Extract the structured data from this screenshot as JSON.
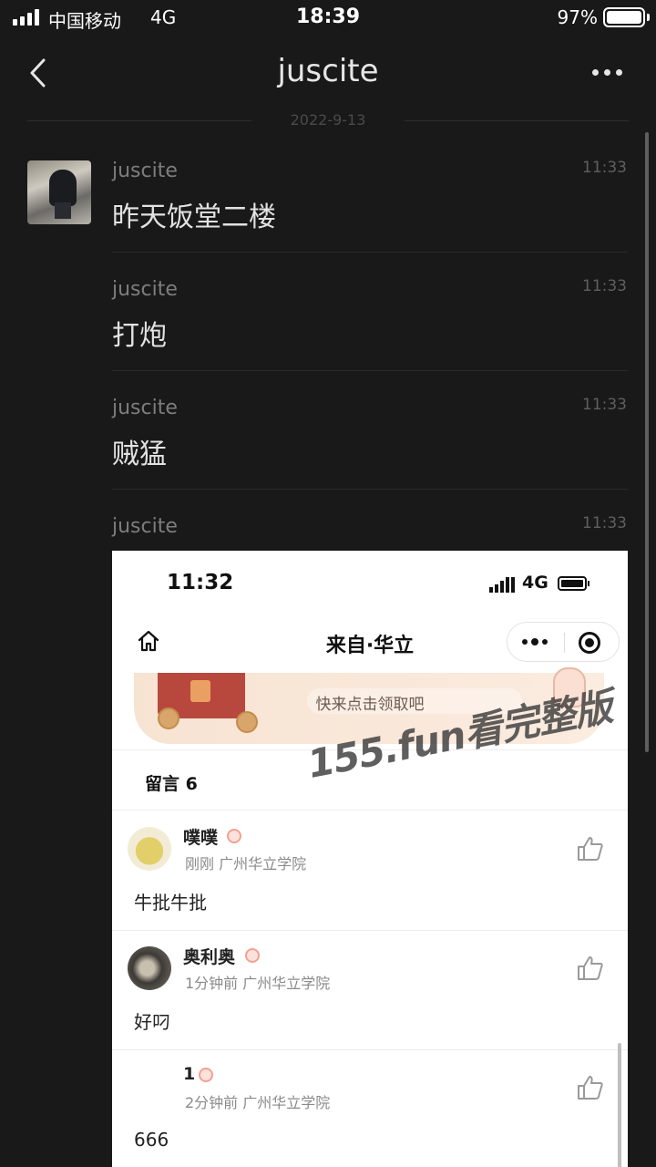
{
  "status_bar": {
    "carrier": "中国移动",
    "network": "4G",
    "time": "18:39",
    "battery": "97%",
    "battery_level": 0.97
  },
  "nav": {
    "title": "juscite",
    "back_icon": "chevron-left-icon",
    "more_icon": "more-dots-icon"
  },
  "date_divider": "2022-9-13",
  "messages": [
    {
      "sender": "juscite",
      "time": "11:33",
      "text": "昨天饭堂二楼"
    },
    {
      "sender": "juscite",
      "time": "11:33",
      "text": "打炮"
    },
    {
      "sender": "juscite",
      "time": "11:33",
      "text": "贼猛"
    },
    {
      "sender": "juscite",
      "time": "11:33",
      "type": "image"
    }
  ],
  "screenshot": {
    "status_time": "11:32",
    "status_network": "4G",
    "title": "来自·华立",
    "banner_text": "快来点击领取吧",
    "comments_header": "留言 6",
    "comments": [
      {
        "name": "噗噗",
        "time": "刚刚",
        "school": "广州华立学院",
        "text": "牛批牛批"
      },
      {
        "name": "奥利奥",
        "time": "1分钟前",
        "school": "广州华立学院",
        "text": "好叼"
      },
      {
        "name": "1",
        "time": "2分钟前",
        "school": "广州华立学院",
        "text": "666"
      }
    ]
  },
  "watermark": "155.fun看完整版",
  "colors": {
    "background": "#191919",
    "text_primary": "#e2e2e2",
    "text_secondary": "#7d7d7d",
    "accent_badge": "#f4a091"
  }
}
